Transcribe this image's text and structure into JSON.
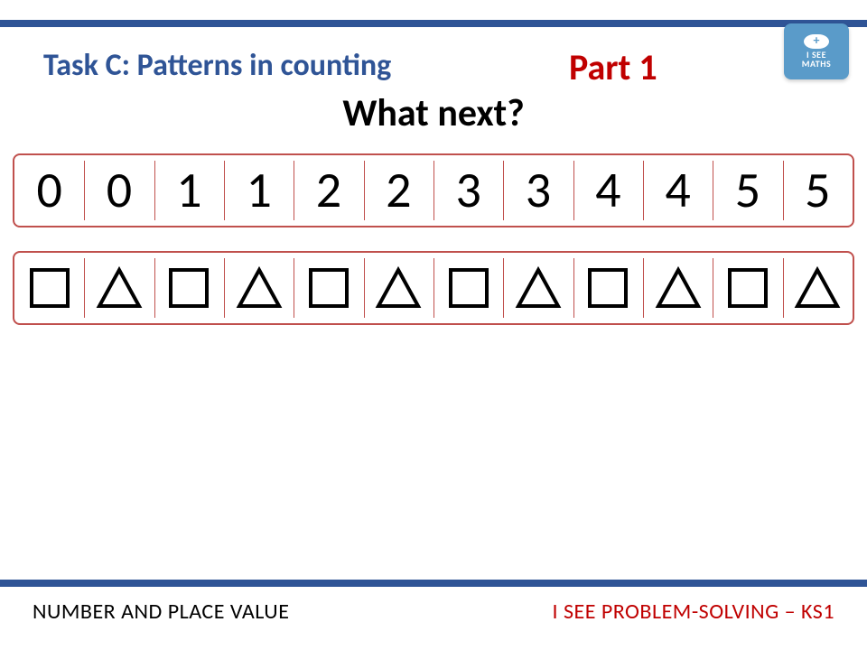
{
  "header": {
    "task_title": "Task C: Patterns in counting",
    "part_label": "Part 1",
    "question": "What next?"
  },
  "logo": {
    "line1": "I SEE",
    "line2": "MATHS"
  },
  "numbers_row": [
    "0",
    "0",
    "1",
    "1",
    "2",
    "2",
    "3",
    "3",
    "4",
    "4",
    "5",
    "5"
  ],
  "shapes_row": [
    "square",
    "triangle",
    "square",
    "triangle",
    "square",
    "triangle",
    "square",
    "triangle",
    "square",
    "triangle",
    "square",
    "triangle"
  ],
  "footer": {
    "left": "NUMBER AND PLACE VALUE",
    "right": "I SEE PROBLEM-SOLVING – KS1"
  }
}
